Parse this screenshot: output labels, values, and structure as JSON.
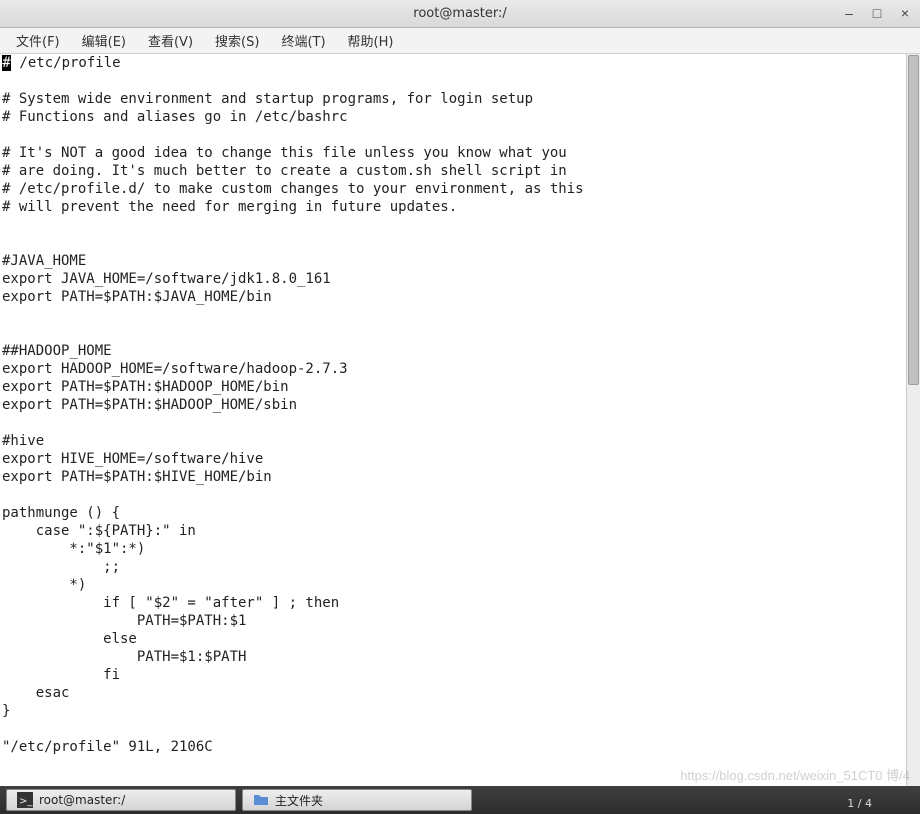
{
  "window": {
    "title": "root@master:/",
    "minimize": "–",
    "maximize": "□",
    "close": "×"
  },
  "menus": {
    "file": "文件(F)",
    "edit": "编辑(E)",
    "view": "查看(V)",
    "search": "搜索(S)",
    "terminal": "终端(T)",
    "help": "帮助(H)"
  },
  "editor": {
    "cursor_char": "#",
    "lines": [
      " /etc/profile",
      "",
      "# System wide environment and startup programs, for login setup",
      "# Functions and aliases go in /etc/bashrc",
      "",
      "# It's NOT a good idea to change this file unless you know what you",
      "# are doing. It's much better to create a custom.sh shell script in",
      "# /etc/profile.d/ to make custom changes to your environment, as this",
      "# will prevent the need for merging in future updates.",
      "",
      "",
      "#JAVA_HOME",
      "export JAVA_HOME=/software/jdk1.8.0_161",
      "export PATH=$PATH:$JAVA_HOME/bin",
      "",
      "",
      "##HADOOP_HOME",
      "export HADOOP_HOME=/software/hadoop-2.7.3",
      "export PATH=$PATH:$HADOOP_HOME/bin",
      "export PATH=$PATH:$HADOOP_HOME/sbin",
      "",
      "#hive",
      "export HIVE_HOME=/software/hive",
      "export PATH=$PATH:$HIVE_HOME/bin",
      "",
      "pathmunge () {",
      "    case \":${PATH}:\" in",
      "        *:\"$1\":*)",
      "            ;;",
      "        *)",
      "            if [ \"$2\" = \"after\" ] ; then",
      "                PATH=$PATH:$1",
      "            else",
      "                PATH=$1:$PATH",
      "            fi",
      "    esac",
      "}",
      "",
      "\"/etc/profile\" 91L, 2106C"
    ]
  },
  "taskbar": {
    "item1": "root@master:/",
    "item2": "主文件夹",
    "tray": "1 / 4"
  },
  "watermark": "https://blog.csdn.net/weixin_51CT0 博/4"
}
